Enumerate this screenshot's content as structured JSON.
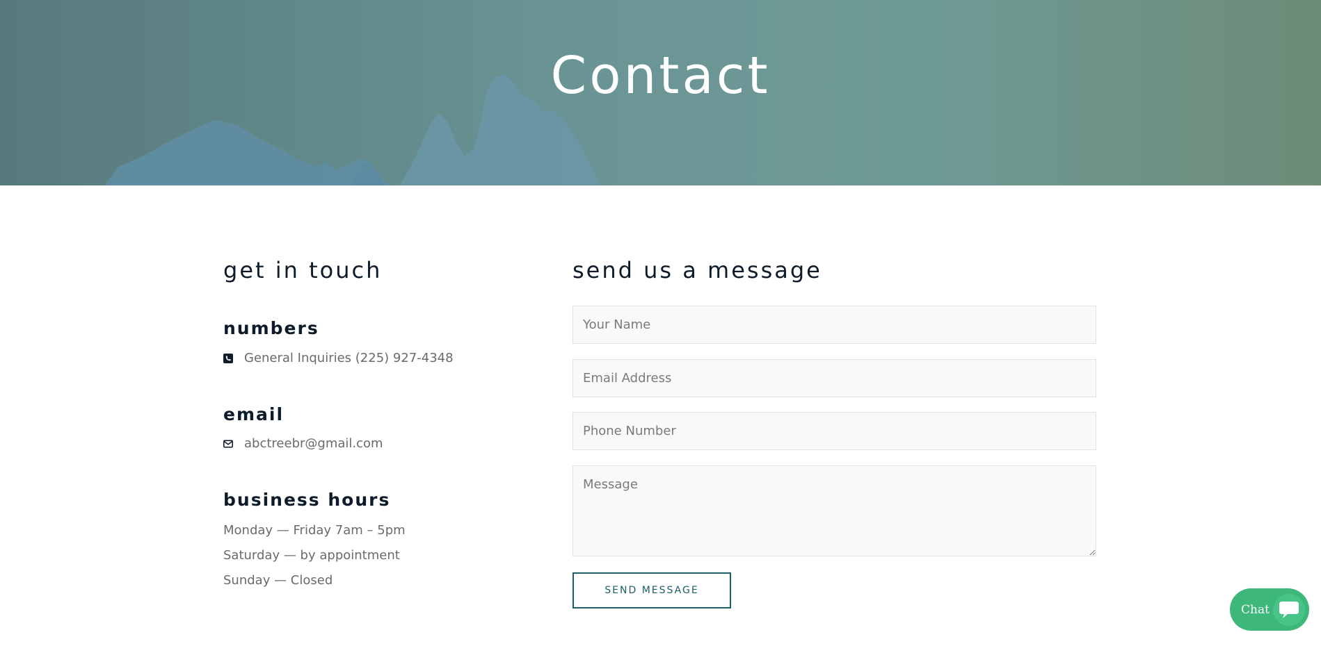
{
  "hero": {
    "title": "Contact"
  },
  "contact_info": {
    "heading": "get in touch",
    "numbers": {
      "heading": "numbers",
      "phone": "General Inquiries (225) 927-4348",
      "icon": "phone-square-icon"
    },
    "email": {
      "heading": "email",
      "address": "abctreebr@gmail.com",
      "icon": "envelope-icon"
    },
    "business_hours": {
      "heading": "business hours",
      "lines": [
        "Monday — Friday 7am – 5pm",
        "Saturday — by appointment",
        "Sunday — Closed"
      ]
    }
  },
  "form": {
    "heading": "send us a message",
    "name_placeholder": "Your Name",
    "email_placeholder": "Email Address",
    "phone_placeholder": "Phone Number",
    "message_placeholder": "Message",
    "submit_label": "SEND MESSAGE",
    "accent_color": "#1b5e64"
  },
  "chat": {
    "label": "Chat",
    "icon": "chat-bubble-icon",
    "color": "#3db77a"
  }
}
